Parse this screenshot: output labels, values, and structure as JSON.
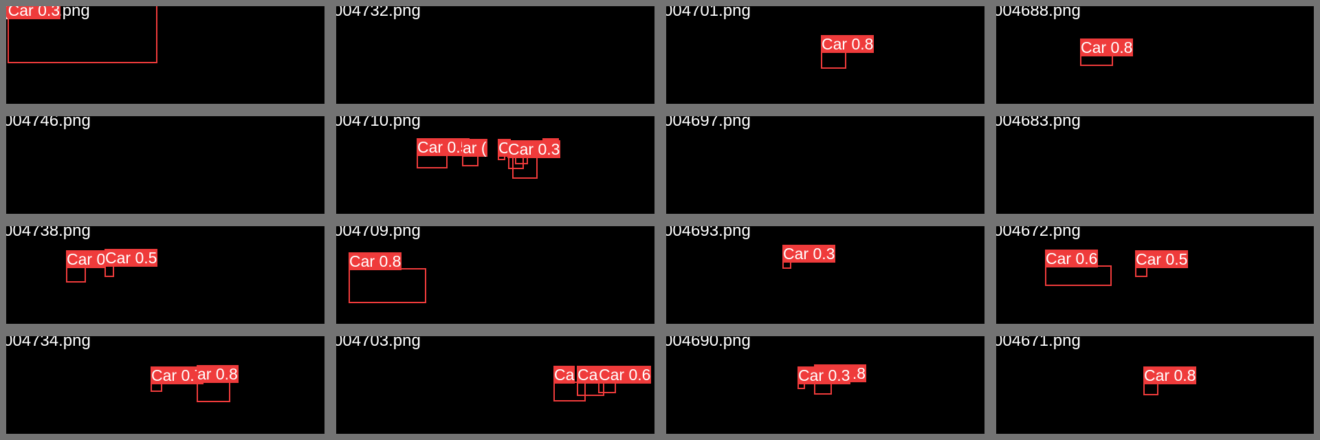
{
  "colors": {
    "tile_border": "#737373",
    "tile_background": "#000000",
    "box": "#ef3b3b",
    "label_text": "#ffffff",
    "gap": "#ffffff"
  },
  "tiles": [
    {
      "filename": "004732.png",
      "detections": []
    },
    {
      "filename": "004701.png",
      "detections": [
        {
          "label": "Car 0.8"
        }
      ]
    },
    {
      "filename": "004688.png",
      "detections": [
        {
          "label": "Car 0.8"
        }
      ]
    },
    {
      "filename": "004746.png",
      "detections": []
    },
    {
      "filename": "004710.png",
      "detections": [
        {
          "label": "Car 0.5"
        },
        {
          "label": "ar ("
        },
        {
          "label": "C"
        },
        {
          "label": "Car 0.3"
        },
        {
          "label": "3"
        }
      ]
    },
    {
      "filename": "004697.png",
      "detections": []
    },
    {
      "filename": "004683.png",
      "detections": []
    },
    {
      "filename": "004738.png",
      "detections": [
        {
          "label": "Car 0"
        },
        {
          "label": "Car 0.5"
        }
      ]
    },
    {
      "filename": "004709.png",
      "detections": [
        {
          "label": "Car 0.8"
        }
      ]
    },
    {
      "filename": "004693.png",
      "detections": [
        {
          "label": "Car 0.3"
        }
      ]
    },
    {
      "filename": "004672.png",
      "detections": [
        {
          "label": "Car 0.6"
        },
        {
          "label": "Car 0.5"
        }
      ]
    },
    {
      "filename": "004734.png",
      "detections": [
        {
          "label": "Car 0.7"
        },
        {
          "label": "ar 0.8"
        }
      ]
    },
    {
      "filename": "004703.png",
      "detections": [
        {
          "label": "Ca"
        },
        {
          "label": "Ca"
        },
        {
          "label": "Car 0.6"
        }
      ]
    },
    {
      "filename": "004690.png",
      "detections": [
        {
          "label": "Car 0.3"
        },
        {
          "label": ".8"
        }
      ]
    },
    {
      "filename": "004671.png",
      "detections": [
        {
          "label": "Car 0.8"
        }
      ]
    }
  ],
  "first_tile": {
    "filename_visible": ".png",
    "detections": [
      {
        "label": "(Car 0.3"
      }
    ]
  }
}
